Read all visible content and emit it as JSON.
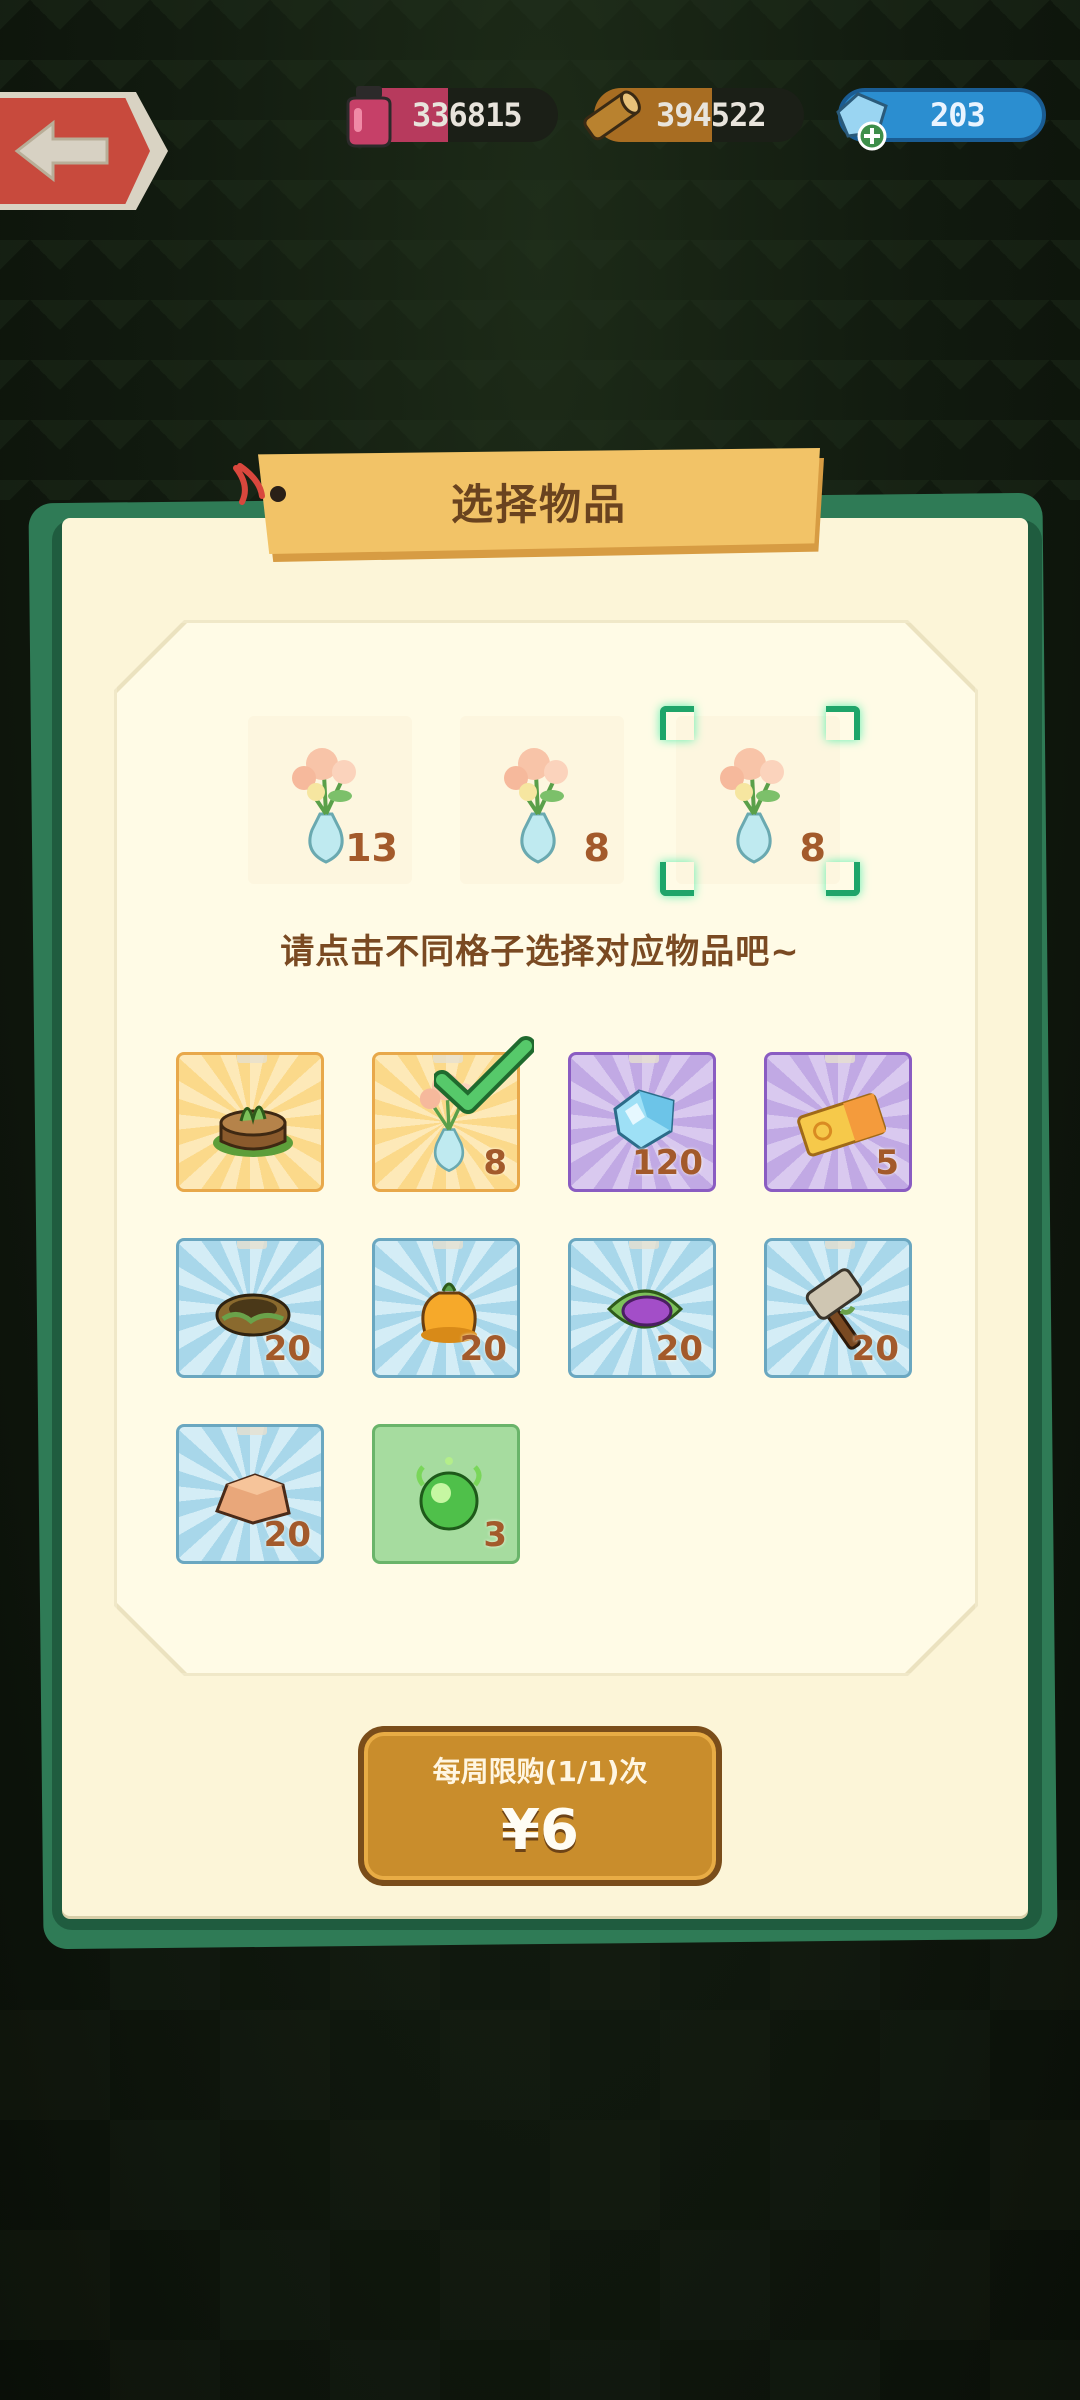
{
  "resources": [
    {
      "name": "potion",
      "value": "336815",
      "icon": "potion-jar-icon",
      "color": "#b73a5d"
    },
    {
      "name": "wood",
      "value": "394522",
      "icon": "wood-log-icon",
      "color": "#a86d22"
    },
    {
      "name": "gem",
      "value": "203",
      "icon": "gem-plus-icon",
      "color": "#2b8ed0"
    }
  ],
  "dialog": {
    "title": "选择物品",
    "hint": "请点击不同格子选择对应物品吧~"
  },
  "selected_slots": [
    {
      "item": "flower-vase",
      "count": "13"
    },
    {
      "item": "flower-vase",
      "count": "8"
    },
    {
      "item": "flower-vase",
      "count": "8",
      "active": true
    }
  ],
  "items": [
    {
      "item": "grass-stump",
      "count": "",
      "rarity": "gold"
    },
    {
      "item": "flower-vase",
      "count": "8",
      "rarity": "gold",
      "checked": true
    },
    {
      "item": "diamond",
      "count": "120",
      "rarity": "purple"
    },
    {
      "item": "ticket",
      "count": "5",
      "rarity": "purple"
    },
    {
      "item": "nest",
      "count": "20",
      "rarity": "blue"
    },
    {
      "item": "orange-sack",
      "count": "20",
      "rarity": "blue"
    },
    {
      "item": "purple-leaf-bowl",
      "count": "20",
      "rarity": "blue"
    },
    {
      "item": "hammer",
      "count": "20",
      "rarity": "blue"
    },
    {
      "item": "rock",
      "count": "20",
      "rarity": "blue"
    },
    {
      "item": "green-orb",
      "count": "3",
      "rarity": "green"
    }
  ],
  "buy_button": {
    "limit": "每周限购(1/1)次",
    "price": "¥6"
  }
}
